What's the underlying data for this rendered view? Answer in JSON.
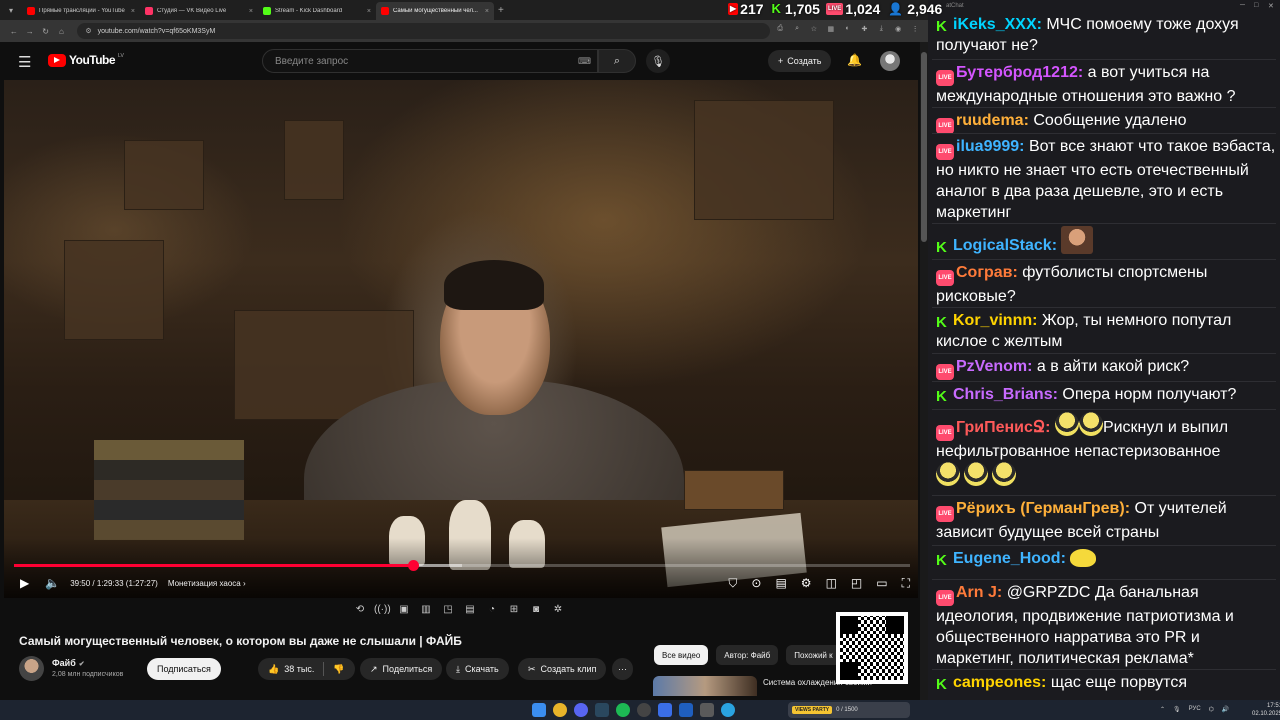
{
  "browser": {
    "tabs": [
      {
        "title": "Прямые трансляции - YouTube",
        "favicon_color": "#ff0000",
        "active": false
      },
      {
        "title": "Студия — VK Видео Live",
        "favicon_color": "#ff3366",
        "active": false
      },
      {
        "title": "Stream - Kick Dashboard",
        "favicon_color": "#53fc18",
        "active": false
      },
      {
        "title": "Самый могущественный чел...",
        "favicon_color": "#ff0000",
        "active": true
      }
    ],
    "url": "youtube.com/watch?v=qf65oKM3SyM",
    "new_tab": "+",
    "close": "×"
  },
  "stream_stats": {
    "youtube_viewers": "217",
    "kick_viewers": "1,705",
    "vk_viewers": "1,024",
    "total_viewers": "2,946",
    "vk_badge": "LIVE",
    "kick_badge": "K"
  },
  "youtube": {
    "logo_text": "YouTube",
    "country_code": "LV",
    "search_placeholder": "Введите запрос",
    "create_label": "Создать",
    "create_plus": "+"
  },
  "player": {
    "current_time": "39:50",
    "duration": "1:29:33",
    "remaining": "(1:27:27)",
    "time_display": "39:50 / 1:29:33 (1:27:27)",
    "chapter": "Монетизация хаоса ›",
    "progress_fraction": 0.445,
    "buffer_fraction": 0.5
  },
  "video": {
    "title": "Самый могущественный человек, о котором вы даже не слышали | ФАЙБ",
    "channel_name": "Файб",
    "subscribers": "2,08 млн подписчиков",
    "subscribe_label": "Подписаться",
    "likes": "38 тыс.",
    "share_label": "Поделиться",
    "download_label": "Скачать",
    "clip_label": "Создать клип",
    "more_label": "···"
  },
  "recommendations": {
    "chips": [
      "Все видео",
      "Автор: Файб",
      "Похожий к"
    ],
    "first_title": "Система охлаждения своими"
  },
  "chat": {
    "window_label": "atChat",
    "messages": [
      {
        "platform": "kick",
        "nick": "iKeks_XXX",
        "color": "#00d4ff",
        "text": "МЧС помоему тоже дохуя получают не?",
        "emotes": []
      },
      {
        "platform": "vk",
        "nick": "Бутерброд1212",
        "color": "#d455ff",
        "text": "а вот учиться на международные отношения это важно ?",
        "emotes": []
      },
      {
        "platform": "vk",
        "nick": "ruudema",
        "color": "#ffb03a",
        "text": "Сообщение удалено",
        "emotes": []
      },
      {
        "platform": "vk",
        "nick": "ilua9999",
        "color": "#3fb4ff",
        "text": "Вот все знают что такое вэбаста, но никто не знает что есть отечественный аналог в два раза дешевле, это и есть маркетинг",
        "emotes": []
      },
      {
        "platform": "kick",
        "nick": "LogicalStack",
        "color": "#3fb4ff",
        "text": "",
        "emotes": [
          "face"
        ]
      },
      {
        "platform": "vk",
        "nick": "Сограв",
        "color": "#ff7b3a",
        "text": "футболисты спортсмены рисковые?",
        "emotes": []
      },
      {
        "platform": "kick",
        "nick": "Kor_vinnn",
        "color": "#ffd400",
        "text": "Жор, ты немного попутал кислое с желтым",
        "emotes": []
      },
      {
        "platform": "vk",
        "nick": "PzVenom",
        "color": "#c86bff",
        "text": "а в айти какой риск?",
        "emotes": []
      },
      {
        "platform": "kick",
        "nick": "Chris_Brians",
        "color": "#c86bff",
        "text": "Опера норм получают?",
        "emotes": []
      },
      {
        "platform": "vk",
        "nick": "ГриПенисՋ",
        "color": "#ff5a5a",
        "text": "Рискнул и выпил нефильтрованное непастеризованное",
        "emotes": [
          "pepe",
          "pepe",
          "pepe",
          "pepe",
          "pepe"
        ]
      },
      {
        "platform": "vk",
        "nick": "Рёрихъ (ГерманГрев)",
        "color": "#ffb03a",
        "text": "От учителей зависит будущее всей страны",
        "emotes": []
      },
      {
        "platform": "kick",
        "nick": "Eugene_Hood",
        "color": "#3fb4ff",
        "text": "",
        "emotes": [
          "duck"
        ]
      },
      {
        "platform": "vk",
        "nick": "Arn J",
        "color": "#ff7b3a",
        "text": "@GRPZDC Да банальная идеология, продвижение патриотизма и общественного нарратива это PR и маркетинг, политическая реклама*",
        "emotes": []
      },
      {
        "platform": "kick",
        "nick": "campeones",
        "color": "#ffd400",
        "text": "щас еще порвутся",
        "emotes": []
      }
    ]
  },
  "taskbar": {
    "media_label": "VIEWS PARTY",
    "media_count": "0 / 1500",
    "lang": "РУС",
    "time": "17:51",
    "date": "02.10.2025"
  },
  "colors": {
    "youtube_red": "#ff0000",
    "progress_red": "#ff0033",
    "kick_green": "#53fc18",
    "vk_live_pink": "#ff4b6e"
  }
}
